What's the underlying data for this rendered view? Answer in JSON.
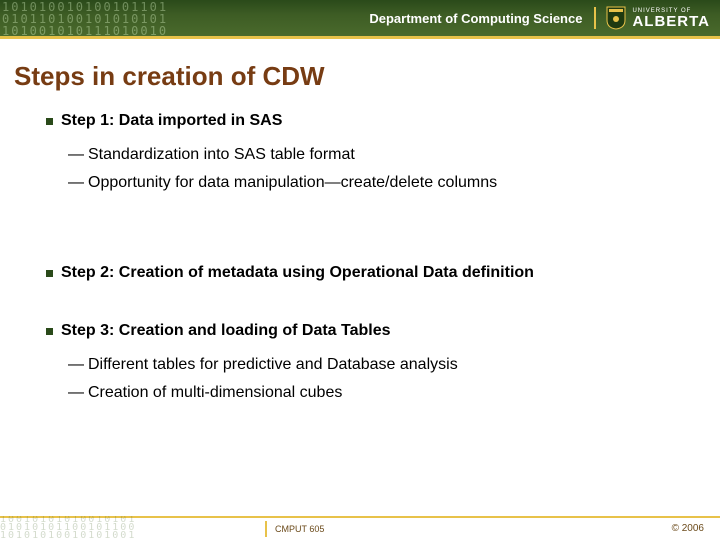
{
  "header": {
    "department": "Department of Computing Science",
    "university_small": "UNIVERSITY OF",
    "university_name": "ALBERTA"
  },
  "slide": {
    "title": "Steps in creation of CDW"
  },
  "steps": [
    {
      "heading": "Step 1: Data imported in SAS",
      "items": [
        "Standardization into SAS table format",
        "Opportunity for data manipulation—create/delete columns"
      ]
    },
    {
      "heading": "Step 2: Creation of metadata using Operational Data definition",
      "items": []
    },
    {
      "heading": "Step 3: Creation and loading of Data Tables",
      "items": [
        "Different tables for predictive and Database analysis",
        "Creation of multi-dimensional cubes"
      ]
    }
  ],
  "footer": {
    "course": "CMPUT 605",
    "copyright": "© 2006"
  }
}
